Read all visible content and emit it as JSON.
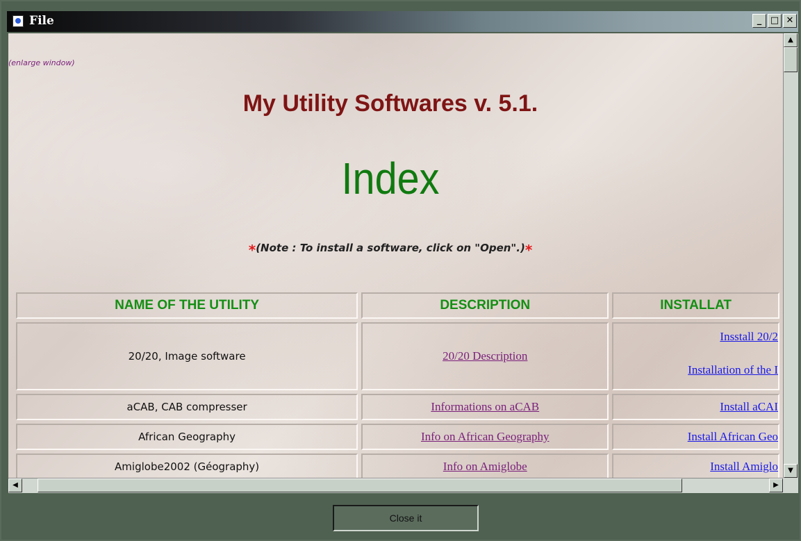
{
  "window": {
    "title": "File",
    "controls": {
      "minimize": "_",
      "maximize": "□",
      "close": "✕"
    }
  },
  "page": {
    "enlarge_link": "(enlarge window)",
    "app_title": "My Utility Softwares v. 5.1.",
    "index_heading": "Index",
    "note_star": "*",
    "note": "(Note : To install a software, click on \"Open\".)"
  },
  "table": {
    "headers": [
      "NAME OF THE UTILITY",
      "DESCRIPTION",
      "INSTALLAT"
    ],
    "rows": [
      {
        "name": "20/20, Image software",
        "description": "20/20 Description",
        "install": "Insstall 20/2",
        "install2": "Installation of the I"
      },
      {
        "name": "aCAB, CAB compresser",
        "description": "Informations on aCAB",
        "install": "Install aCAI"
      },
      {
        "name": "African Geography",
        "description": "Info on African Geography",
        "install": "Install African Geo"
      },
      {
        "name": "Amiglobe2002 (Géography)",
        "description": "Info on Amiglobe",
        "install": "Install Amiglo"
      }
    ]
  },
  "footer": {
    "close_label": "Close it"
  },
  "colors": {
    "title_red": "#7e1414",
    "index_green": "#0f7a0f",
    "visited_link": "#7a1f7a",
    "link": "#1a1ae6"
  }
}
